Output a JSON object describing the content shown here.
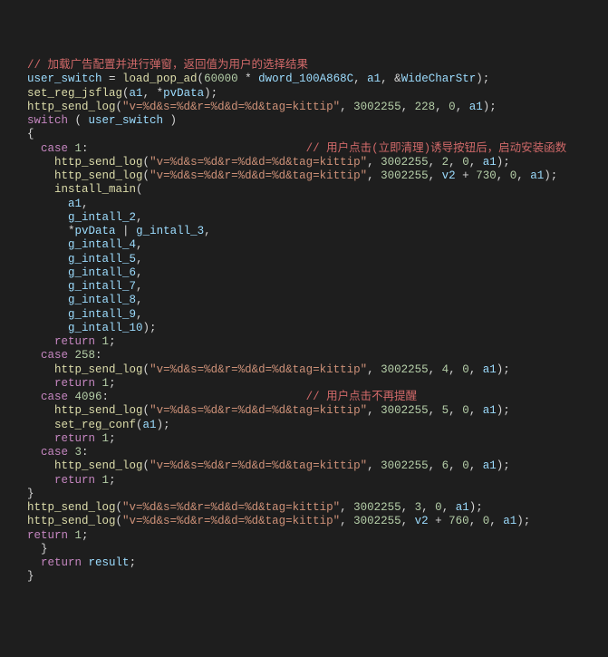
{
  "tokens": [
    {
      "cls": "c-comment",
      "t": "// 加载广告配置并进行弹窗，返回值为用户的选择结果\n"
    },
    {
      "cls": "c-var",
      "t": "user_switch"
    },
    {
      "cls": "c-op",
      "t": " = "
    },
    {
      "cls": "c-func",
      "t": "load_pop_ad"
    },
    {
      "cls": "c-paren",
      "t": "("
    },
    {
      "cls": "c-num",
      "t": "60000"
    },
    {
      "cls": "c-op",
      "t": " * "
    },
    {
      "cls": "c-var",
      "t": "dword_100A868C"
    },
    {
      "cls": "c-punct",
      "t": ", "
    },
    {
      "cls": "c-var",
      "t": "a1"
    },
    {
      "cls": "c-punct",
      "t": ", "
    },
    {
      "cls": "c-op",
      "t": "&"
    },
    {
      "cls": "c-var",
      "t": "WideCharStr"
    },
    {
      "cls": "c-paren",
      "t": ")"
    },
    {
      "cls": "c-punct",
      "t": ";\n"
    },
    {
      "cls": "c-func",
      "t": "set_reg_jsflag"
    },
    {
      "cls": "c-paren",
      "t": "("
    },
    {
      "cls": "c-var",
      "t": "a1"
    },
    {
      "cls": "c-punct",
      "t": ", "
    },
    {
      "cls": "c-op",
      "t": "*"
    },
    {
      "cls": "c-var",
      "t": "pvData"
    },
    {
      "cls": "c-paren",
      "t": ")"
    },
    {
      "cls": "c-punct",
      "t": ";\n"
    },
    {
      "cls": "c-func",
      "t": "http_send_log"
    },
    {
      "cls": "c-paren",
      "t": "("
    },
    {
      "cls": "c-str",
      "t": "\"v=%d&s=%d&r=%d&d=%d&tag=kittip\""
    },
    {
      "cls": "c-punct",
      "t": ", "
    },
    {
      "cls": "c-num",
      "t": "3002255"
    },
    {
      "cls": "c-punct",
      "t": ", "
    },
    {
      "cls": "c-num",
      "t": "228"
    },
    {
      "cls": "c-punct",
      "t": ", "
    },
    {
      "cls": "c-num",
      "t": "0"
    },
    {
      "cls": "c-punct",
      "t": ", "
    },
    {
      "cls": "c-var",
      "t": "a1"
    },
    {
      "cls": "c-paren",
      "t": ")"
    },
    {
      "cls": "c-punct",
      "t": ";\n"
    },
    {
      "cls": "c-switch",
      "t": "switch"
    },
    {
      "cls": "c-op",
      "t": " ( "
    },
    {
      "cls": "c-var",
      "t": "user_switch"
    },
    {
      "cls": "c-op",
      "t": " )\n"
    },
    {
      "cls": "c-punct",
      "t": "{\n"
    },
    {
      "cls": "c-switch",
      "t": "  case"
    },
    {
      "cls": "c-op",
      "t": " "
    },
    {
      "cls": "c-num",
      "t": "1"
    },
    {
      "cls": "c-punct",
      "t": ":"
    },
    {
      "cls": "c-op",
      "t": "                                "
    },
    {
      "cls": "c-comment",
      "t": "// 用户点击(立即清理)诱导按钮后，启动安装函数\n"
    },
    {
      "cls": "c-op",
      "t": "    "
    },
    {
      "cls": "c-func",
      "t": "http_send_log"
    },
    {
      "cls": "c-paren",
      "t": "("
    },
    {
      "cls": "c-str",
      "t": "\"v=%d&s=%d&r=%d&d=%d&tag=kittip\""
    },
    {
      "cls": "c-punct",
      "t": ", "
    },
    {
      "cls": "c-num",
      "t": "3002255"
    },
    {
      "cls": "c-punct",
      "t": ", "
    },
    {
      "cls": "c-num",
      "t": "2"
    },
    {
      "cls": "c-punct",
      "t": ", "
    },
    {
      "cls": "c-num",
      "t": "0"
    },
    {
      "cls": "c-punct",
      "t": ", "
    },
    {
      "cls": "c-var",
      "t": "a1"
    },
    {
      "cls": "c-paren",
      "t": ")"
    },
    {
      "cls": "c-punct",
      "t": ";\n"
    },
    {
      "cls": "c-op",
      "t": "    "
    },
    {
      "cls": "c-func",
      "t": "http_send_log"
    },
    {
      "cls": "c-paren",
      "t": "("
    },
    {
      "cls": "c-str",
      "t": "\"v=%d&s=%d&r=%d&d=%d&tag=kittip\""
    },
    {
      "cls": "c-punct",
      "t": ", "
    },
    {
      "cls": "c-num",
      "t": "3002255"
    },
    {
      "cls": "c-punct",
      "t": ", "
    },
    {
      "cls": "c-var",
      "t": "v2"
    },
    {
      "cls": "c-op",
      "t": " + "
    },
    {
      "cls": "c-num",
      "t": "730"
    },
    {
      "cls": "c-punct",
      "t": ", "
    },
    {
      "cls": "c-num",
      "t": "0"
    },
    {
      "cls": "c-punct",
      "t": ", "
    },
    {
      "cls": "c-var",
      "t": "a1"
    },
    {
      "cls": "c-paren",
      "t": ")"
    },
    {
      "cls": "c-punct",
      "t": ";\n"
    },
    {
      "cls": "c-op",
      "t": "    "
    },
    {
      "cls": "c-func",
      "t": "install_main"
    },
    {
      "cls": "c-paren",
      "t": "(\n"
    },
    {
      "cls": "c-op",
      "t": "      "
    },
    {
      "cls": "c-var",
      "t": "a1"
    },
    {
      "cls": "c-punct",
      "t": ",\n"
    },
    {
      "cls": "c-op",
      "t": "      "
    },
    {
      "cls": "c-var",
      "t": "g_intall_2"
    },
    {
      "cls": "c-punct",
      "t": ",\n"
    },
    {
      "cls": "c-op",
      "t": "      "
    },
    {
      "cls": "c-op",
      "t": "*"
    },
    {
      "cls": "c-var",
      "t": "pvData"
    },
    {
      "cls": "c-op",
      "t": " | "
    },
    {
      "cls": "c-var",
      "t": "g_intall_3"
    },
    {
      "cls": "c-punct",
      "t": ",\n"
    },
    {
      "cls": "c-op",
      "t": "      "
    },
    {
      "cls": "c-var",
      "t": "g_intall_4"
    },
    {
      "cls": "c-punct",
      "t": ",\n"
    },
    {
      "cls": "c-op",
      "t": "      "
    },
    {
      "cls": "c-var",
      "t": "g_intall_5"
    },
    {
      "cls": "c-punct",
      "t": ",\n"
    },
    {
      "cls": "c-op",
      "t": "      "
    },
    {
      "cls": "c-var",
      "t": "g_intall_6"
    },
    {
      "cls": "c-punct",
      "t": ",\n"
    },
    {
      "cls": "c-op",
      "t": "      "
    },
    {
      "cls": "c-var",
      "t": "g_intall_7"
    },
    {
      "cls": "c-punct",
      "t": ",\n"
    },
    {
      "cls": "c-op",
      "t": "      "
    },
    {
      "cls": "c-var",
      "t": "g_intall_8"
    },
    {
      "cls": "c-punct",
      "t": ",\n"
    },
    {
      "cls": "c-op",
      "t": "      "
    },
    {
      "cls": "c-var",
      "t": "g_intall_9"
    },
    {
      "cls": "c-punct",
      "t": ",\n"
    },
    {
      "cls": "c-op",
      "t": "      "
    },
    {
      "cls": "c-var",
      "t": "g_intall_10"
    },
    {
      "cls": "c-paren",
      "t": ")"
    },
    {
      "cls": "c-punct",
      "t": ";\n"
    },
    {
      "cls": "c-op",
      "t": "    "
    },
    {
      "cls": "c-switch",
      "t": "return"
    },
    {
      "cls": "c-op",
      "t": " "
    },
    {
      "cls": "c-num",
      "t": "1"
    },
    {
      "cls": "c-punct",
      "t": ";\n"
    },
    {
      "cls": "c-switch",
      "t": "  case"
    },
    {
      "cls": "c-op",
      "t": " "
    },
    {
      "cls": "c-num",
      "t": "258"
    },
    {
      "cls": "c-punct",
      "t": ":\n"
    },
    {
      "cls": "c-op",
      "t": "    "
    },
    {
      "cls": "c-func",
      "t": "http_send_log"
    },
    {
      "cls": "c-paren",
      "t": "("
    },
    {
      "cls": "c-str",
      "t": "\"v=%d&s=%d&r=%d&d=%d&tag=kittip\""
    },
    {
      "cls": "c-punct",
      "t": ", "
    },
    {
      "cls": "c-num",
      "t": "3002255"
    },
    {
      "cls": "c-punct",
      "t": ", "
    },
    {
      "cls": "c-num",
      "t": "4"
    },
    {
      "cls": "c-punct",
      "t": ", "
    },
    {
      "cls": "c-num",
      "t": "0"
    },
    {
      "cls": "c-punct",
      "t": ", "
    },
    {
      "cls": "c-var",
      "t": "a1"
    },
    {
      "cls": "c-paren",
      "t": ")"
    },
    {
      "cls": "c-punct",
      "t": ";\n"
    },
    {
      "cls": "c-op",
      "t": "    "
    },
    {
      "cls": "c-switch",
      "t": "return"
    },
    {
      "cls": "c-op",
      "t": " "
    },
    {
      "cls": "c-num",
      "t": "1"
    },
    {
      "cls": "c-punct",
      "t": ";\n"
    },
    {
      "cls": "c-switch",
      "t": "  case"
    },
    {
      "cls": "c-op",
      "t": " "
    },
    {
      "cls": "c-num",
      "t": "4096"
    },
    {
      "cls": "c-punct",
      "t": ":"
    },
    {
      "cls": "c-op",
      "t": "                             "
    },
    {
      "cls": "c-comment",
      "t": "// 用户点击不再提醒\n"
    },
    {
      "cls": "c-op",
      "t": "    "
    },
    {
      "cls": "c-func",
      "t": "http_send_log"
    },
    {
      "cls": "c-paren",
      "t": "("
    },
    {
      "cls": "c-str",
      "t": "\"v=%d&s=%d&r=%d&d=%d&tag=kittip\""
    },
    {
      "cls": "c-punct",
      "t": ", "
    },
    {
      "cls": "c-num",
      "t": "3002255"
    },
    {
      "cls": "c-punct",
      "t": ", "
    },
    {
      "cls": "c-num",
      "t": "5"
    },
    {
      "cls": "c-punct",
      "t": ", "
    },
    {
      "cls": "c-num",
      "t": "0"
    },
    {
      "cls": "c-punct",
      "t": ", "
    },
    {
      "cls": "c-var",
      "t": "a1"
    },
    {
      "cls": "c-paren",
      "t": ")"
    },
    {
      "cls": "c-punct",
      "t": ";\n"
    },
    {
      "cls": "c-op",
      "t": "    "
    },
    {
      "cls": "c-func",
      "t": "set_reg_conf"
    },
    {
      "cls": "c-paren",
      "t": "("
    },
    {
      "cls": "c-var",
      "t": "a1"
    },
    {
      "cls": "c-paren",
      "t": ")"
    },
    {
      "cls": "c-punct",
      "t": ";\n"
    },
    {
      "cls": "c-op",
      "t": "    "
    },
    {
      "cls": "c-switch",
      "t": "return"
    },
    {
      "cls": "c-op",
      "t": " "
    },
    {
      "cls": "c-num",
      "t": "1"
    },
    {
      "cls": "c-punct",
      "t": ";\n"
    },
    {
      "cls": "c-switch",
      "t": "  case"
    },
    {
      "cls": "c-op",
      "t": " "
    },
    {
      "cls": "c-num",
      "t": "3"
    },
    {
      "cls": "c-punct",
      "t": ":\n"
    },
    {
      "cls": "c-op",
      "t": "    "
    },
    {
      "cls": "c-func",
      "t": "http_send_log"
    },
    {
      "cls": "c-paren",
      "t": "("
    },
    {
      "cls": "c-str",
      "t": "\"v=%d&s=%d&r=%d&d=%d&tag=kittip\""
    },
    {
      "cls": "c-punct",
      "t": ", "
    },
    {
      "cls": "c-num",
      "t": "3002255"
    },
    {
      "cls": "c-punct",
      "t": ", "
    },
    {
      "cls": "c-num",
      "t": "6"
    },
    {
      "cls": "c-punct",
      "t": ", "
    },
    {
      "cls": "c-num",
      "t": "0"
    },
    {
      "cls": "c-punct",
      "t": ", "
    },
    {
      "cls": "c-var",
      "t": "a1"
    },
    {
      "cls": "c-paren",
      "t": ")"
    },
    {
      "cls": "c-punct",
      "t": ";\n"
    },
    {
      "cls": "c-op",
      "t": "    "
    },
    {
      "cls": "c-switch",
      "t": "return"
    },
    {
      "cls": "c-op",
      "t": " "
    },
    {
      "cls": "c-num",
      "t": "1"
    },
    {
      "cls": "c-punct",
      "t": ";\n"
    },
    {
      "cls": "c-punct",
      "t": "}\n"
    },
    {
      "cls": "c-func",
      "t": "http_send_log"
    },
    {
      "cls": "c-paren",
      "t": "("
    },
    {
      "cls": "c-str",
      "t": "\"v=%d&s=%d&r=%d&d=%d&tag=kittip\""
    },
    {
      "cls": "c-punct",
      "t": ", "
    },
    {
      "cls": "c-num",
      "t": "3002255"
    },
    {
      "cls": "c-punct",
      "t": ", "
    },
    {
      "cls": "c-num",
      "t": "3"
    },
    {
      "cls": "c-punct",
      "t": ", "
    },
    {
      "cls": "c-num",
      "t": "0"
    },
    {
      "cls": "c-punct",
      "t": ", "
    },
    {
      "cls": "c-var",
      "t": "a1"
    },
    {
      "cls": "c-paren",
      "t": ")"
    },
    {
      "cls": "c-punct",
      "t": ";\n"
    },
    {
      "cls": "c-func",
      "t": "http_send_log"
    },
    {
      "cls": "c-paren",
      "t": "("
    },
    {
      "cls": "c-str",
      "t": "\"v=%d&s=%d&r=%d&d=%d&tag=kittip\""
    },
    {
      "cls": "c-punct",
      "t": ", "
    },
    {
      "cls": "c-num",
      "t": "3002255"
    },
    {
      "cls": "c-punct",
      "t": ", "
    },
    {
      "cls": "c-var",
      "t": "v2"
    },
    {
      "cls": "c-op",
      "t": " + "
    },
    {
      "cls": "c-num",
      "t": "760"
    },
    {
      "cls": "c-punct",
      "t": ", "
    },
    {
      "cls": "c-num",
      "t": "0"
    },
    {
      "cls": "c-punct",
      "t": ", "
    },
    {
      "cls": "c-var",
      "t": "a1"
    },
    {
      "cls": "c-paren",
      "t": ")"
    },
    {
      "cls": "c-punct",
      "t": ";\n"
    },
    {
      "cls": "c-switch",
      "t": "return"
    },
    {
      "cls": "c-op",
      "t": " "
    },
    {
      "cls": "c-num",
      "t": "1"
    },
    {
      "cls": "c-punct",
      "t": ";"
    }
  ],
  "outer_lines": {
    "before": [],
    "after_close1": "  }",
    "return_line": "  return result;",
    "after_close2": "}"
  }
}
